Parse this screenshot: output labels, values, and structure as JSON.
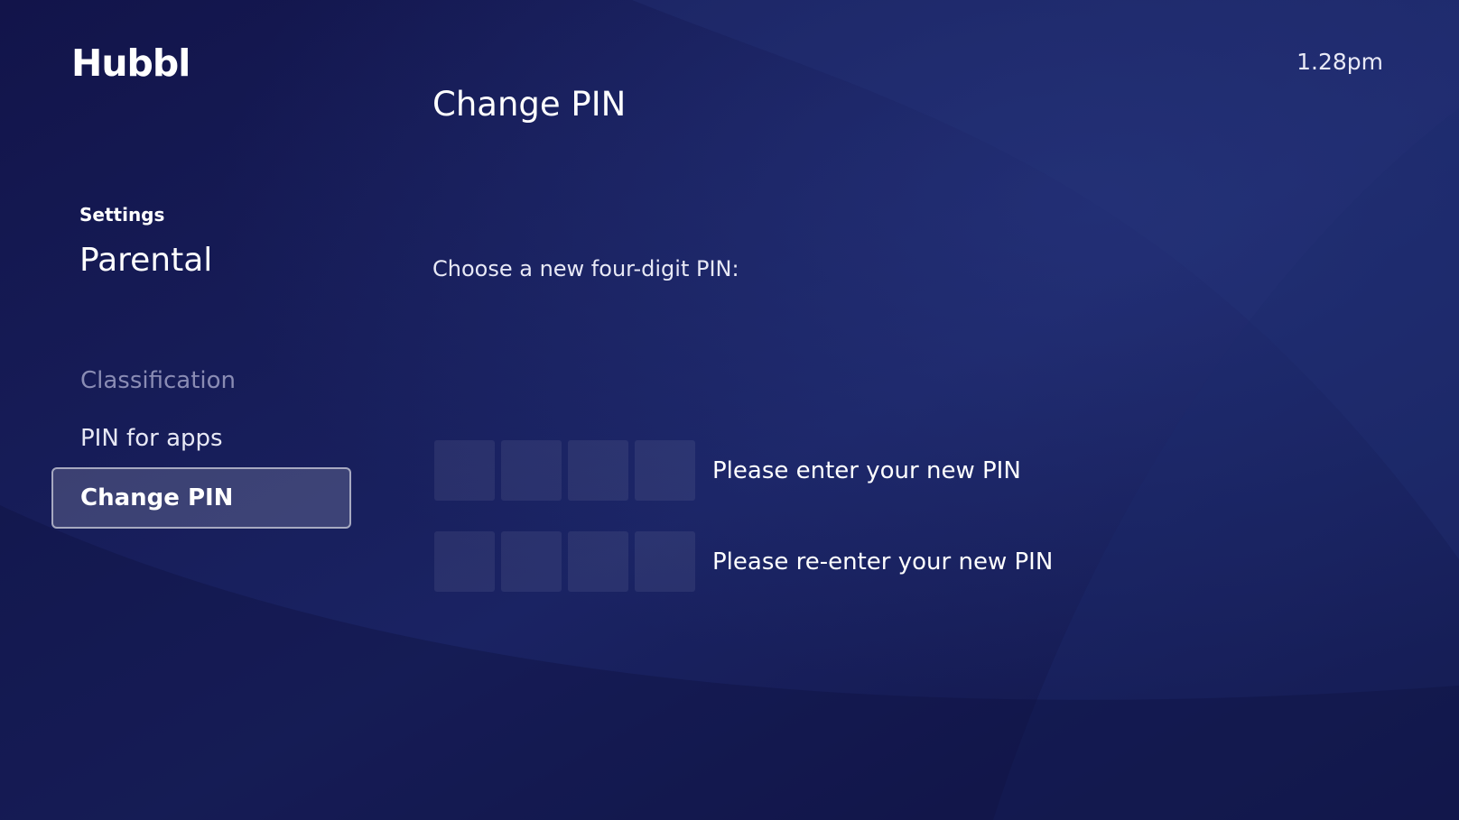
{
  "brand": {
    "logo_text": "Hubbl"
  },
  "header": {
    "time": "1.28pm"
  },
  "page": {
    "title": "Change PIN"
  },
  "sidebar": {
    "breadcrumb": "Settings",
    "section_title": "Parental",
    "items": [
      {
        "label": "Classification",
        "state": "dimmed"
      },
      {
        "label": "PIN for apps",
        "state": "normal"
      },
      {
        "label": "Change PIN",
        "state": "selected"
      }
    ]
  },
  "main": {
    "prompt": "Choose a new four-digit PIN:",
    "pin_entry": {
      "label": "Please enter your new PIN",
      "digits": [
        "",
        "",
        "",
        ""
      ]
    },
    "pin_confirm": {
      "label": "Please re-enter your new PIN",
      "digits": [
        "",
        "",
        "",
        ""
      ]
    }
  },
  "colors": {
    "background": "#13154a",
    "selected_border": "#c9cbe6",
    "dim_text": "#8a8cb4"
  }
}
